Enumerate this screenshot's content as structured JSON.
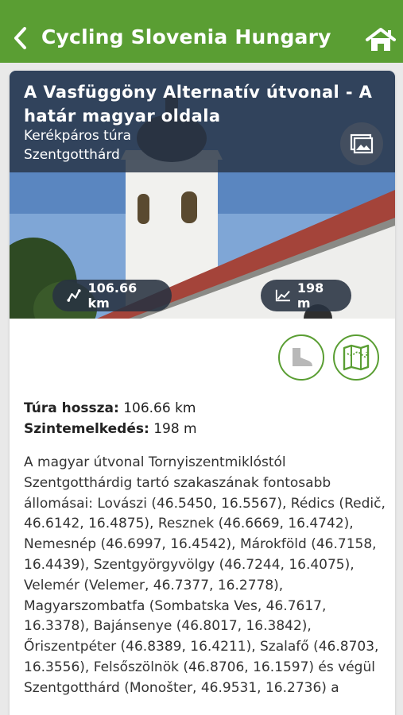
{
  "appbar": {
    "title": "Cycling Slovenia Hungary",
    "back_icon": "chevron-left-icon",
    "home_icon": "home-icon",
    "color": "#5a9e33"
  },
  "tour": {
    "title": "A Vasfüggöny Alternatív útvonal - A határ magyar oldala",
    "type": "Kerékpáros túra",
    "location": "Szentgotthárd",
    "length_badge": "106.66 km",
    "elevation_badge": "198 m",
    "length_label": "Túra hossza:",
    "length_value": "106.66 km",
    "elevation_label": "Szintemelkedés:",
    "elevation_value": "198 m",
    "description": "A magyar útvonal Tornyiszentmiklóstól Szentgotthárdig tartó szakaszának fontosabb állomásai: Lovászi (46.5450, 16.5567), Rédics (Redič, 46.6142, 16.4875), Resznek (46.6669, 16.4742), Nemesnép (46.6997, 16.4542), Márokföld (46.7158, 16.4439), Szentgyörgyvölgy (46.7244, 16.4075), Velemér (Velemer, 46.7377, 16.2778), Magyarszombatfa (Sombatska Ves, 46.7617, 16.3378), Bajánsenye (46.8017, 16.3842), Őriszentpéter (46.8389, 16.4211), Szalafő (46.8703, 16.3556), Felsőszölnök (46.8706, 16.1597) és végül Szentgotthárd (Monošter, 46.9531, 16.2736) a"
  },
  "icons": {
    "gallery": "gallery-icon",
    "route": "route-icon",
    "elevation": "elevation-chart-icon",
    "walk": "boot-icon",
    "map": "map-icon"
  }
}
